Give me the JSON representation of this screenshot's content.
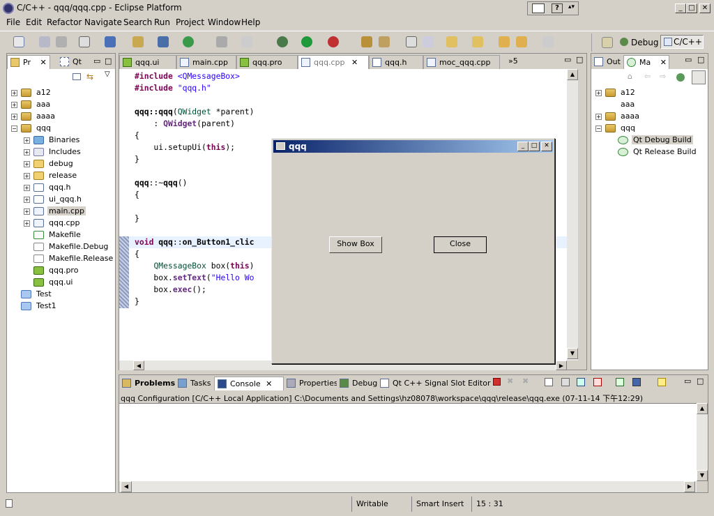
{
  "window": {
    "title": "C/C++ - qqq/qqq.cpp - Eclipse Platform"
  },
  "menu": [
    "File",
    "Edit",
    "Refactor",
    "Navigate",
    "Search",
    "Run",
    "Project",
    "Window",
    "Help"
  ],
  "perspectives": {
    "debug": "Debug",
    "cpp": "C/C++"
  },
  "left": {
    "tab1": "Pr",
    "tab2": "Qt",
    "tree": [
      {
        "label": "a12",
        "depth": 0,
        "exp": "+",
        "icon": "project"
      },
      {
        "label": "aaa",
        "depth": 0,
        "exp": "+",
        "icon": "project"
      },
      {
        "label": "aaaa",
        "depth": 0,
        "exp": "+",
        "icon": "project"
      },
      {
        "label": "qqq",
        "depth": 0,
        "exp": "-",
        "icon": "project"
      },
      {
        "label": "Binaries",
        "depth": 1,
        "exp": "+",
        "icon": "binaries"
      },
      {
        "label": "Includes",
        "depth": 1,
        "exp": "+",
        "icon": "includes"
      },
      {
        "label": "debug",
        "depth": 1,
        "exp": "+",
        "icon": "folder"
      },
      {
        "label": "release",
        "depth": 1,
        "exp": "+",
        "icon": "folder"
      },
      {
        "label": "qqq.h",
        "depth": 1,
        "exp": "+",
        "icon": "h"
      },
      {
        "label": "ui_qqq.h",
        "depth": 1,
        "exp": "+",
        "icon": "h"
      },
      {
        "label": "main.cpp",
        "depth": 1,
        "exp": "+",
        "icon": "c",
        "sel": true
      },
      {
        "label": "qqq.cpp",
        "depth": 1,
        "exp": "+",
        "icon": "c"
      },
      {
        "label": "Makefile",
        "depth": 1,
        "exp": "",
        "icon": "make"
      },
      {
        "label": "Makefile.Debug",
        "depth": 1,
        "exp": "",
        "icon": "file"
      },
      {
        "label": "Makefile.Release",
        "depth": 1,
        "exp": "",
        "icon": "file"
      },
      {
        "label": "qqq.pro",
        "depth": 1,
        "exp": "",
        "icon": "qt"
      },
      {
        "label": "qqq.ui",
        "depth": 1,
        "exp": "",
        "icon": "qt"
      },
      {
        "label": "Test",
        "depth": 0,
        "exp": "",
        "icon": "folderblue"
      },
      {
        "label": "Test1",
        "depth": 0,
        "exp": "",
        "icon": "folderblue"
      }
    ]
  },
  "editor": {
    "tabs": [
      {
        "label": "qqq.ui",
        "icon": "qt"
      },
      {
        "label": "main.cpp",
        "icon": "c"
      },
      {
        "label": "qqq.pro",
        "icon": "qt"
      },
      {
        "label": "qqq.cpp",
        "icon": "c",
        "active": true
      },
      {
        "label": "qqq.h",
        "icon": "h"
      },
      {
        "label": "moc_qqq.cpp",
        "icon": "c"
      }
    ],
    "overflow": "»5",
    "lines": [
      [
        [
          "#include ",
          "kw"
        ],
        [
          "<QMessageBox>",
          "st"
        ]
      ],
      [
        [
          "#include ",
          "kw"
        ],
        [
          "\"qqq.h\"",
          "st"
        ]
      ],
      [],
      [
        [
          "qqq",
          "bold"
        ],
        [
          "::",
          "bold"
        ],
        [
          "qqq",
          "bold"
        ],
        [
          "(",
          ""
        ],
        [
          "QWidget",
          "ty"
        ],
        [
          " *parent)",
          ""
        ]
      ],
      [
        [
          "    : ",
          ""
        ],
        [
          "QWidget",
          "fn"
        ],
        [
          "(parent)",
          ""
        ]
      ],
      [
        [
          "{",
          ""
        ]
      ],
      [
        [
          "    ui.setupUi(",
          ""
        ],
        [
          "this",
          "kw"
        ],
        [
          ");",
          ""
        ]
      ],
      [
        [
          "}",
          ""
        ]
      ],
      [],
      [
        [
          "qqq",
          "bold"
        ],
        [
          "::~",
          ""
        ],
        [
          "qqq",
          "bold"
        ],
        [
          "()",
          ""
        ]
      ],
      [
        [
          "{",
          ""
        ]
      ],
      [],
      [
        [
          "}",
          ""
        ]
      ],
      [],
      [
        [
          "void ",
          "kw"
        ],
        [
          "qqq",
          "bold"
        ],
        [
          "::",
          ""
        ],
        [
          "on_Button1_clic",
          "bold"
        ]
      ],
      [
        [
          "{",
          ""
        ]
      ],
      [
        [
          "    ",
          ""
        ],
        [
          "QMessageBox",
          "ty"
        ],
        [
          " box(",
          ""
        ],
        [
          "this",
          "kw"
        ],
        [
          ")",
          ""
        ]
      ],
      [
        [
          "    box.",
          ""
        ],
        [
          "setText",
          "fn"
        ],
        [
          "(",
          ""
        ],
        [
          "\"Hello Wo",
          "st"
        ]
      ],
      [
        [
          "    box.",
          ""
        ],
        [
          "exec",
          "fn"
        ],
        [
          "();",
          ""
        ]
      ],
      [
        [
          "}",
          ""
        ]
      ]
    ]
  },
  "dialog": {
    "title": "qqq",
    "show_box": "Show Box",
    "close": "Close"
  },
  "right": {
    "tab1": "Out",
    "tab2": "Ma",
    "tree": [
      {
        "label": "a12",
        "depth": 0,
        "exp": "+",
        "icon": "project"
      },
      {
        "label": "aaa",
        "depth": 0,
        "exp": "",
        "icon": "none"
      },
      {
        "label": "aaaa",
        "depth": 0,
        "exp": "+",
        "icon": "project"
      },
      {
        "label": "qqq",
        "depth": 0,
        "exp": "-",
        "icon": "project"
      },
      {
        "label": "Qt Debug Build",
        "depth": 1,
        "exp": "",
        "icon": "target",
        "sel": true
      },
      {
        "label": "Qt Release Build",
        "depth": 1,
        "exp": "",
        "icon": "target"
      }
    ]
  },
  "bottom": {
    "tabs": [
      {
        "label": "Problems",
        "bold": true
      },
      {
        "label": "Tasks"
      },
      {
        "label": "Console",
        "active": true
      },
      {
        "label": "Properties"
      },
      {
        "label": "Debug"
      },
      {
        "label": "Qt C++ Signal Slot Editor"
      }
    ],
    "console_header": "qqq Configuration [C/C++ Local Application] C:\\Documents and Settings\\hz08078\\workspace\\qqq\\release\\qqq.exe (07-11-14 下午12:29)"
  },
  "status": {
    "writable": "Writable",
    "insert": "Smart Insert",
    "position": "15 : 31"
  }
}
